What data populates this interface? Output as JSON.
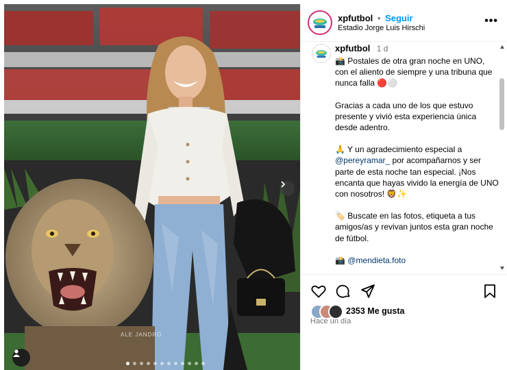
{
  "post": {
    "username": "xpfutbol",
    "follow_label": "Seguir",
    "location": "Estadio Jorge Luis Hirschi",
    "time_short": "1 d",
    "time_ago": "Hace un día",
    "likes_label": "2353 Me gusta",
    "caption": {
      "p1": "📸 Postales de otra gran noche en UNO, con el aliento de siempre y una tribuna que nunca falla 🔴⚪",
      "p2": "Gracias a cada uno de los que estuvo presente y vivió esta experiencia única desde adentro.",
      "p3_prefix": "🙏 Y un agradecimiento especial a ",
      "p3_link": "@pereyramar_",
      "p3_suffix": " por acompañarnos y ser parte de esta noche tan especial. ¡Nos encanta que hayas vivido la energía de UNO con nosotros! 🦁✨",
      "p4": "🏷️ Buscate en las fotos, etiqueta a tus amigos/as y revivan juntos esta gran noche de fútbol.",
      "p5_prefix": "📸 ",
      "p5_link": "@mendieta.foto"
    },
    "avatar_text": "XP FÚTBOL",
    "watermark": "ALE JANDRO",
    "carousel": {
      "total": 12,
      "active": 0
    }
  },
  "icons": {
    "more": "more-options-icon",
    "next": "chevron-right-icon",
    "user_tag": "user-tag-icon",
    "like": "heart-icon",
    "comment": "comment-icon",
    "share": "share-icon",
    "save": "bookmark-icon"
  },
  "colors": {
    "follow": "#0095f6",
    "link": "#00376b",
    "secondary_text": "#737373"
  }
}
